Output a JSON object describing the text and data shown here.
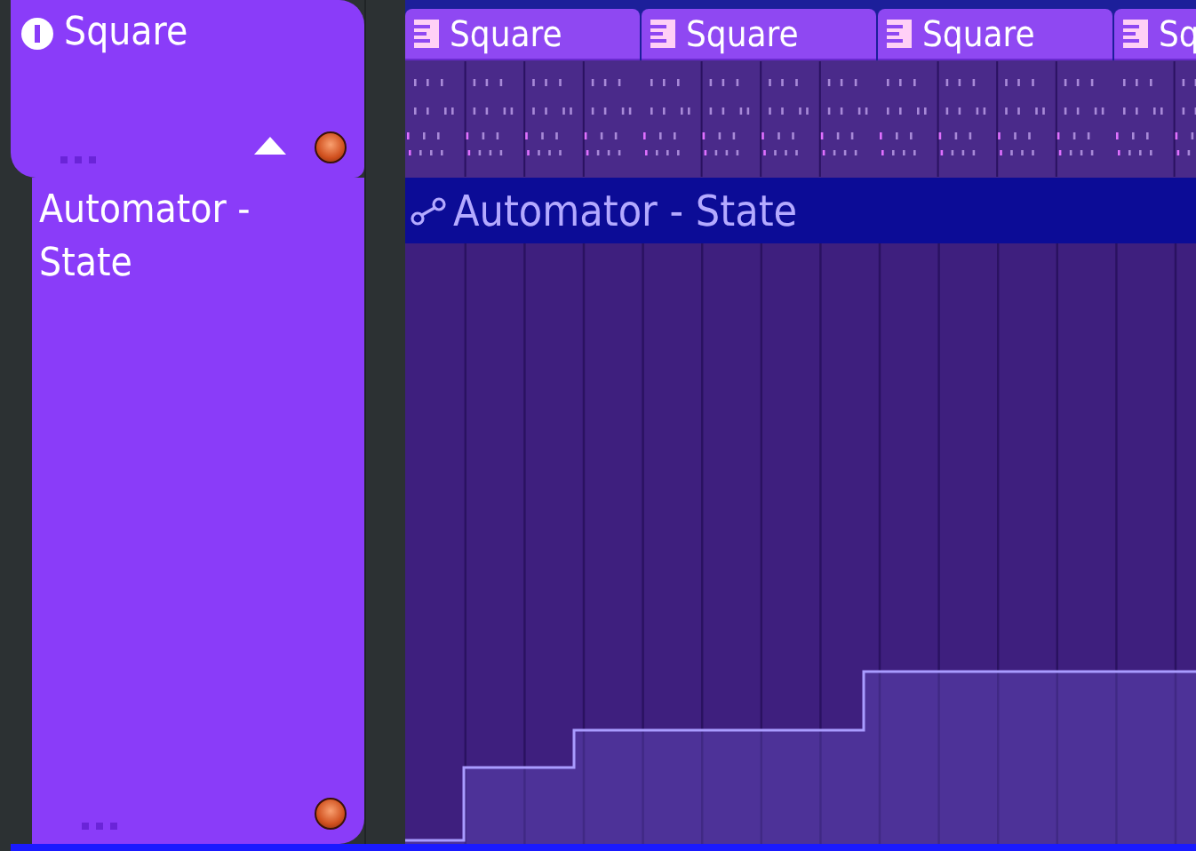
{
  "tracks": [
    {
      "name": "Square",
      "kind": "pattern",
      "clips": [
        {
          "label": "Square"
        },
        {
          "label": "Square"
        },
        {
          "label": "Square"
        },
        {
          "label": "Sq"
        }
      ]
    },
    {
      "name": "Automator - State",
      "kind": "automation",
      "clips": [
        {
          "label": "Automator - State"
        }
      ]
    }
  ]
}
